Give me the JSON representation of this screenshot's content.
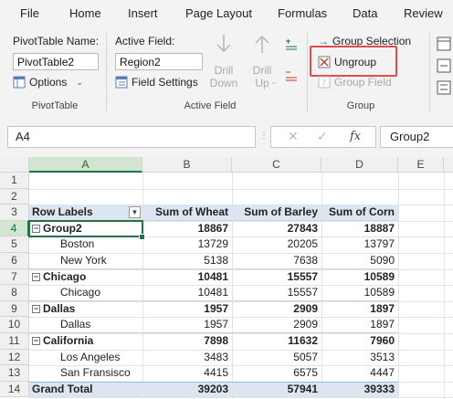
{
  "tabs": [
    "File",
    "Home",
    "Insert",
    "Page Layout",
    "Formulas",
    "Data",
    "Review"
  ],
  "ribbon": {
    "pivottable": {
      "name_label": "PivotTable Name:",
      "name_value": "PivotTable2",
      "options_label": "Options",
      "group_label": "PivotTable"
    },
    "active_field": {
      "label": "Active Field:",
      "value": "Region2",
      "settings_label": "Field Settings",
      "drill_down": "Drill\nDown",
      "drill_down_line1": "Drill",
      "drill_down_line2": "Down",
      "drill_up_line1": "Drill",
      "drill_up_line2": "Up",
      "group_label": "Active Field"
    },
    "group": {
      "group_selection": "Group Selection",
      "ungroup": "Ungroup",
      "group_field": "Group Field",
      "group_label": "Group"
    }
  },
  "formula_bar": {
    "name_box": "A4",
    "fx": "fx",
    "value": "Group2"
  },
  "columns": [
    "A",
    "B",
    "C",
    "D",
    "E"
  ],
  "rows": [
    "1",
    "2",
    "3",
    "4",
    "5",
    "6",
    "7",
    "8",
    "9",
    "10",
    "11",
    "12",
    "13",
    "14"
  ],
  "pivot": {
    "headers": [
      "Row Labels",
      "Sum of Wheat",
      "Sum of Barley",
      "Sum of Corn"
    ],
    "data": [
      {
        "label": "Group2",
        "wheat": "18867",
        "barley": "27843",
        "corn": "18887",
        "level": 0
      },
      {
        "label": "Boston",
        "wheat": "13729",
        "barley": "20205",
        "corn": "13797",
        "level": 1
      },
      {
        "label": "New York",
        "wheat": "5138",
        "barley": "7638",
        "corn": "5090",
        "level": 1
      },
      {
        "label": "Chicago",
        "wheat": "10481",
        "barley": "15557",
        "corn": "10589",
        "level": 0
      },
      {
        "label": "Chicago",
        "wheat": "10481",
        "barley": "15557",
        "corn": "10589",
        "level": 1
      },
      {
        "label": "Dallas",
        "wheat": "1957",
        "barley": "2909",
        "corn": "1897",
        "level": 0
      },
      {
        "label": "Dallas",
        "wheat": "1957",
        "barley": "2909",
        "corn": "1897",
        "level": 1
      },
      {
        "label": "California",
        "wheat": "7898",
        "barley": "11632",
        "corn": "7960",
        "level": 0
      },
      {
        "label": "Los Angeles",
        "wheat": "3483",
        "barley": "5057",
        "corn": "3513",
        "level": 1
      },
      {
        "label": "San Fransisco",
        "wheat": "4415",
        "barley": "6575",
        "corn": "4447",
        "level": 1
      }
    ],
    "total": {
      "label": "Grand Total",
      "wheat": "39203",
      "barley": "57941",
      "corn": "39333"
    }
  },
  "colors": {
    "accent_green": "#217346",
    "pivot_header": "#dce6f1",
    "highlight_red": "#e54b4b"
  }
}
